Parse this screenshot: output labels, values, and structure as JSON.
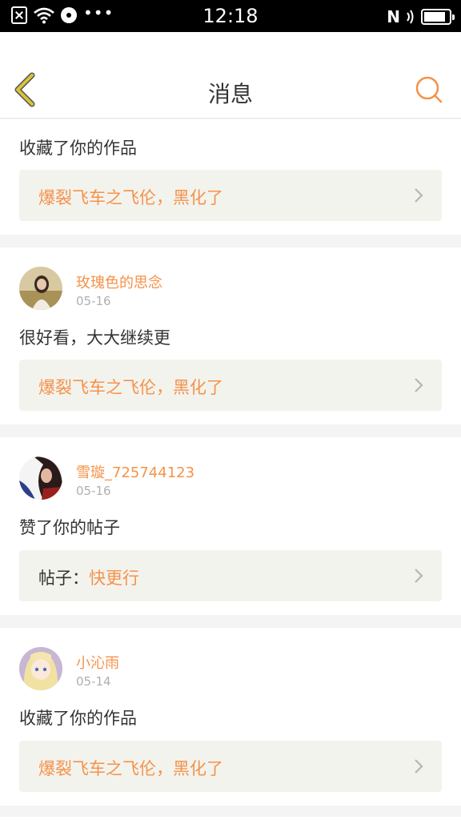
{
  "status_bar": {
    "time": "12:18",
    "nfc": "N",
    "more": "•••",
    "icons": [
      "sim-off-icon",
      "wifi-icon",
      "disc-icon",
      "battery-icon"
    ]
  },
  "header": {
    "title": "消息",
    "back_icon": "chevron-left-icon",
    "search_icon": "search-icon"
  },
  "colors": {
    "accent": "#f5924a",
    "back": "#d7c43a",
    "quote_bg": "#f3f3ed"
  },
  "messages": [
    {
      "action": "收藏了你的作品",
      "quote": "爆裂飞车之飞伦，黑化了"
    },
    {
      "user": "玫瑰色的思念",
      "date": "05-16",
      "action": "很好看，大大继续更",
      "quote": "爆裂飞车之飞伦，黑化了"
    },
    {
      "user": "雪璇_725744123",
      "date": "05-16",
      "action": "赞了你的帖子",
      "quote_prefix": "帖子：",
      "quote": "快更行"
    },
    {
      "user": "小沁雨",
      "date": "05-14",
      "action": "收藏了你的作品",
      "quote": "爆裂飞车之飞伦，黑化了"
    }
  ]
}
